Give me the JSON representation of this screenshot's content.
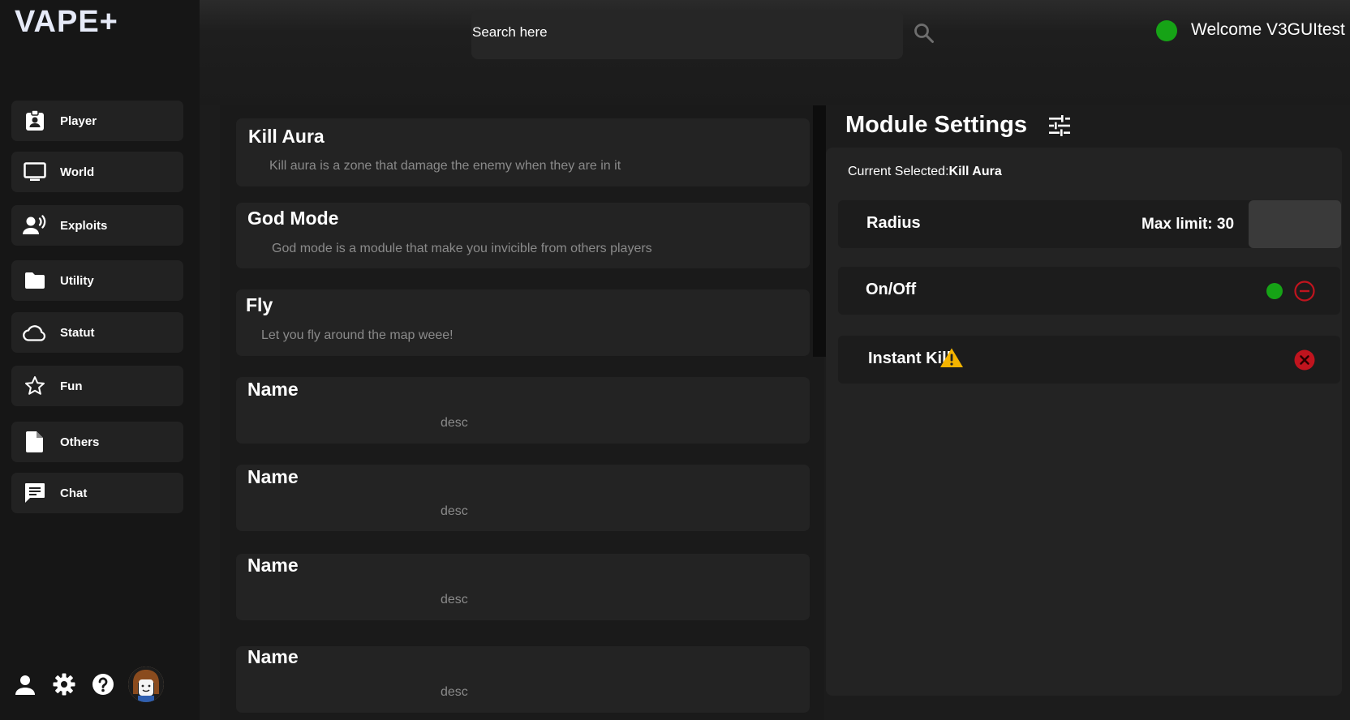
{
  "app": {
    "logo": "VAPE+"
  },
  "header": {
    "search_placeholder": "Search here",
    "welcome": "Welcome V3GUItest",
    "status_color": "#16a316"
  },
  "sidebar": {
    "items": [
      {
        "label": "Player",
        "icon": "clipboard-user-icon"
      },
      {
        "label": "World",
        "icon": "monitor-icon"
      },
      {
        "label": "Exploits",
        "icon": "speaking-person-icon"
      },
      {
        "label": "Utility",
        "icon": "folder-icon"
      },
      {
        "label": "Statut",
        "icon": "cloud-icon"
      },
      {
        "label": "Fun",
        "icon": "star-icon"
      },
      {
        "label": "Others",
        "icon": "document-icon"
      },
      {
        "label": "Chat",
        "icon": "chat-icon"
      }
    ],
    "bottom_icons": [
      "user-icon",
      "gear-icon",
      "help-icon",
      "avatar"
    ]
  },
  "modules": [
    {
      "title": "Kill Aura",
      "desc": "Kill aura is a zone that damage the enemy when they are in it"
    },
    {
      "title": "God Mode",
      "desc": "God mode is a module that make you invicible from others players"
    },
    {
      "title": "Fly",
      "desc": "Let you fly around the map weee!"
    },
    {
      "title": "Name",
      "desc": "desc"
    },
    {
      "title": "Name",
      "desc": "desc"
    },
    {
      "title": "Name",
      "desc": "desc"
    },
    {
      "title": "Name",
      "desc": "desc"
    }
  ],
  "settings": {
    "title": "Module Settings",
    "current_label": "Current Selected:",
    "current_value": "Kill Aura",
    "rows": [
      {
        "label": "Radius",
        "max_limit": "Max limit: 30",
        "input_value": ""
      },
      {
        "label": "On/Off",
        "state": "on"
      },
      {
        "label": "Instant Kill",
        "state": "off"
      }
    ]
  },
  "colors": {
    "on": "#16a316",
    "off": "#c0141e",
    "warning": "#f5b400"
  }
}
